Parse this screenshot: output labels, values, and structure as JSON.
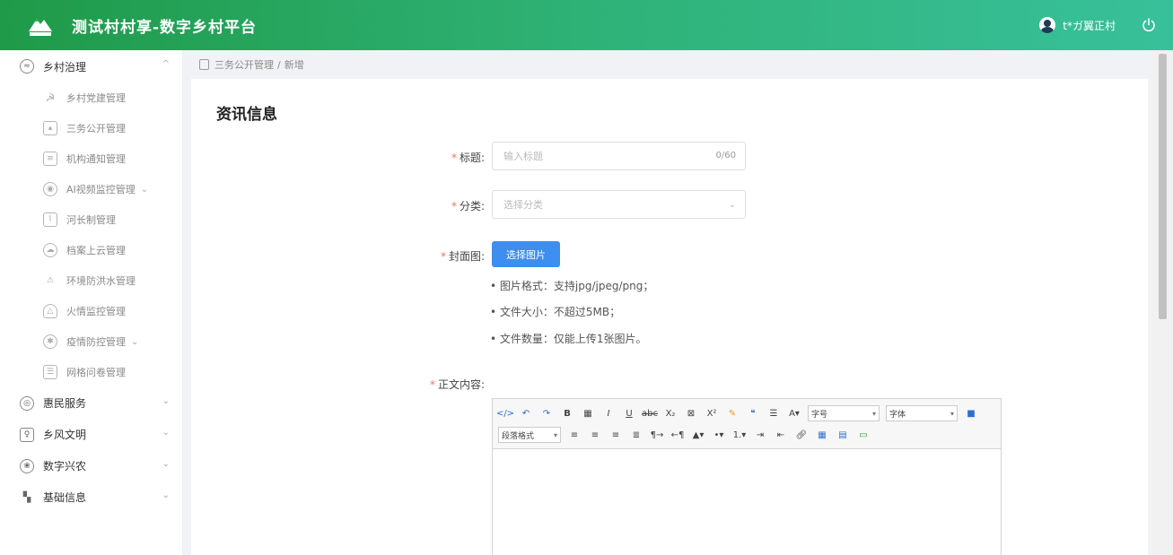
{
  "header": {
    "title": "测试村村享-数字乡村平台",
    "user": "t*ガ翼正村",
    "bg_start": "#1f9a48",
    "bg_end": "#38c09a"
  },
  "sidebar": {
    "groups": [
      {
        "label": "乡村治理",
        "icon": "village-governance-icon",
        "expanded": true,
        "children": [
          {
            "label": "乡村党建管理",
            "icon": "party-building-icon"
          },
          {
            "label": "三务公开管理",
            "icon": "public-affairs-icon"
          },
          {
            "label": "机构通知管理",
            "icon": "notice-icon"
          },
          {
            "label": "AI视频监控管理",
            "icon": "camera-icon",
            "has_children": true
          },
          {
            "label": "河长制管理",
            "icon": "river-icon"
          },
          {
            "label": "档案上云管理",
            "icon": "cloud-archive-icon"
          },
          {
            "label": "环境防洪水管理",
            "icon": "flood-icon"
          },
          {
            "label": "火情监控管理",
            "icon": "fire-icon"
          },
          {
            "label": "疫情防控管理",
            "icon": "epidemic-icon",
            "has_children": true
          },
          {
            "label": "网格问卷管理",
            "icon": "survey-icon"
          }
        ]
      },
      {
        "label": "惠民服务",
        "icon": "service-icon",
        "expanded": false
      },
      {
        "label": "乡风文明",
        "icon": "civilization-icon",
        "expanded": false
      },
      {
        "label": "数字兴农",
        "icon": "agriculture-icon",
        "expanded": false
      },
      {
        "label": "基础信息",
        "icon": "info-icon",
        "expanded": false
      }
    ]
  },
  "breadcrumb": {
    "section": "三务公开管理",
    "current": "新增"
  },
  "form": {
    "section_title": "资讯信息",
    "title_label": "标题:",
    "title_placeholder": "输入标题",
    "title_counter": "0/60",
    "category_label": "分类:",
    "category_placeholder": "选择分类",
    "cover_label": "封面图:",
    "cover_button": "选择图片",
    "hints": [
      "• 图片格式：支持jpg/jpeg/png；",
      "• 文件大小：不超过5MB；",
      "• 文件数量：仅能上传1张图片。"
    ],
    "content_label": "正文内容:"
  },
  "editor": {
    "font_size_label": "字号",
    "font_family_label": "字体",
    "paragraph_label": "段落格式"
  },
  "colors": {
    "accent": "#3d8eef",
    "required": "#f56c6c"
  }
}
